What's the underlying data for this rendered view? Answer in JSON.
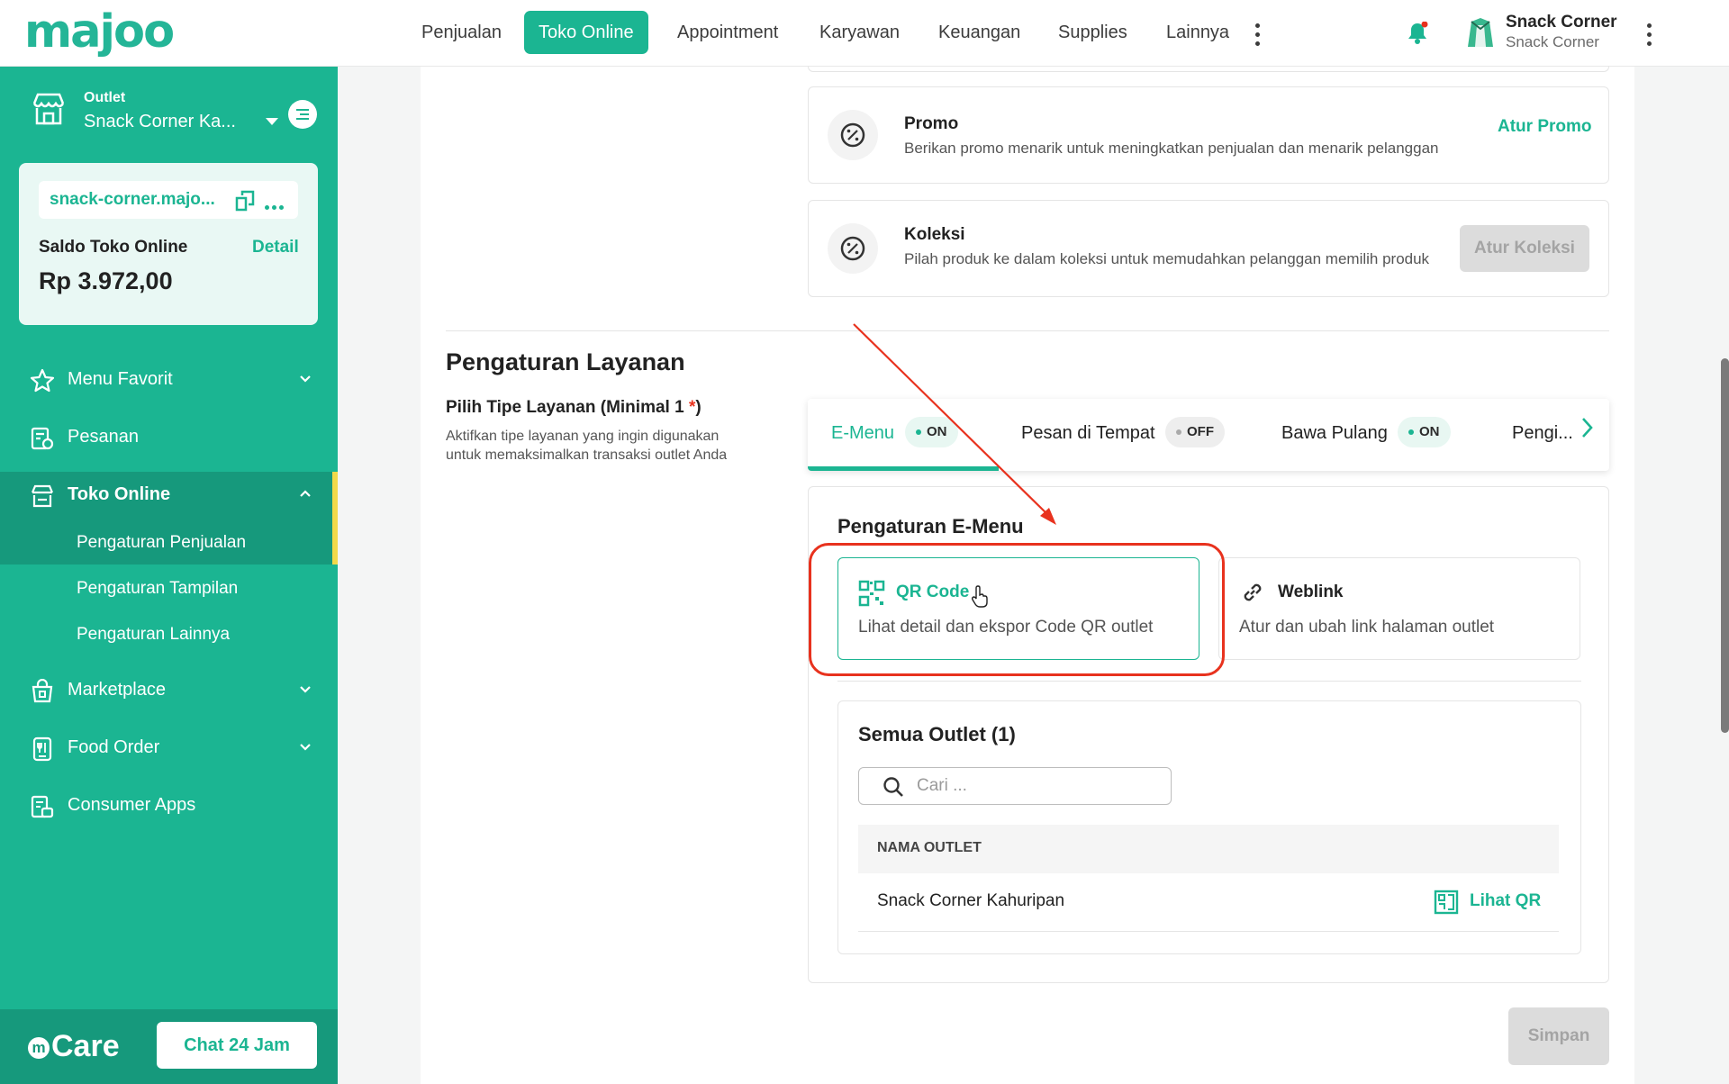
{
  "header": {
    "logo": "majoo",
    "nav": [
      "Penjualan",
      "Toko Online",
      "Appointment",
      "Karyawan",
      "Keuangan",
      "Supplies",
      "Lainnya"
    ],
    "active_nav": "Toko Online",
    "user_name": "Snack Corner",
    "user_subtitle": "Snack Corner"
  },
  "sidebar": {
    "outlet_label": "Outlet",
    "outlet_name": "Snack Corner Ka...",
    "store_url": "snack-corner.majo...",
    "balance_label": "Saldo Toko Online",
    "detail_link": "Detail",
    "balance_value": "Rp 3.972,00",
    "menu": [
      {
        "label": "Menu Favorit"
      },
      {
        "label": "Pesanan"
      },
      {
        "label": "Toko Online"
      },
      {
        "label": "Marketplace"
      },
      {
        "label": "Food Order"
      },
      {
        "label": "Consumer Apps"
      }
    ],
    "submenu": [
      "Pengaturan Penjualan",
      "Pengaturan Tampilan",
      "Pengaturan Lainnya"
    ],
    "care_logo": "Care",
    "chat_button": "Chat 24 Jam"
  },
  "promo": {
    "title": "Promo",
    "desc": "Berikan promo menarik untuk meningkatkan penjualan dan menarik pelanggan",
    "action": "Atur Promo"
  },
  "koleksi": {
    "title": "Koleksi",
    "desc": "Pilah produk ke dalam koleksi untuk memudahkan pelanggan memilih produk",
    "action": "Atur Koleksi"
  },
  "layanan": {
    "title": "Pengaturan Layanan",
    "subtitle": "Pilih Tipe Layanan (Minimal 1",
    "required": "*",
    "close_paren": ")",
    "desc_line1": "Aktifkan tipe layanan yang ingin digunakan",
    "desc_line2": "untuk memaksimalkan transaksi outlet Anda",
    "tabs": [
      {
        "label": "E-Menu",
        "status": "ON"
      },
      {
        "label": "Pesan di Tempat",
        "status": "OFF"
      },
      {
        "label": "Bawa Pulang",
        "status": "ON"
      },
      {
        "label": "Pengi..."
      }
    ]
  },
  "emenu": {
    "title": "Pengaturan E-Menu",
    "qr_title": "QR Code",
    "qr_desc": "Lihat detail dan ekspor Code QR outlet",
    "web_title": "Weblink",
    "web_desc": "Atur dan ubah link halaman outlet"
  },
  "outlets": {
    "title": "Semua Outlet (1)",
    "search_placeholder": "Cari ...",
    "column_header": "NAMA OUTLET",
    "rows": [
      {
        "name": "Snack Corner Kahuripan",
        "action": "Lihat QR"
      }
    ]
  },
  "footer": {
    "save_button": "Simpan"
  },
  "colors": {
    "brand": "#1bb592",
    "annotation": "#e8321e"
  }
}
